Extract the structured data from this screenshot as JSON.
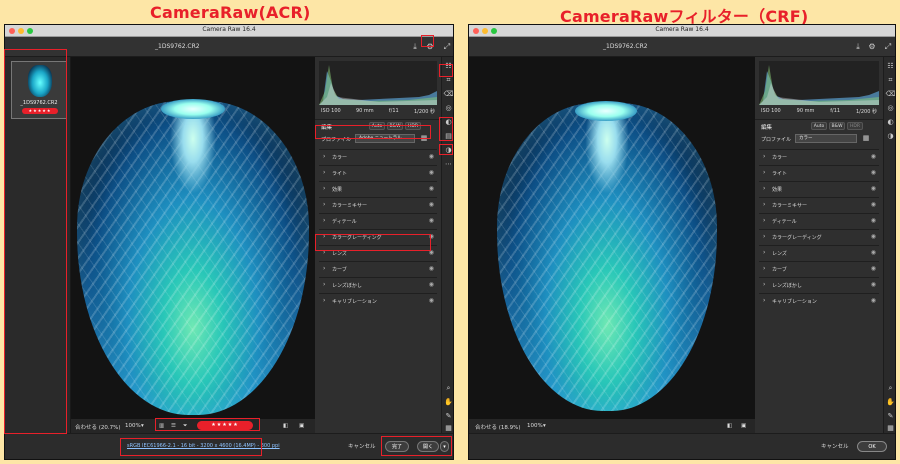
{
  "headings": {
    "acr": "CameraRaw(ACR)",
    "crf": "CameraRawフィルター（CRF)"
  },
  "colors": {
    "accent": "#e8202a",
    "panel": "#2f2f2f",
    "canvas": "#131313"
  },
  "acr": {
    "title": "Camera Raw 16.4",
    "filename": "_1DS9762.CR2",
    "filmstrip": {
      "name": "_1DS9762.CR2",
      "rating": "★★★★★"
    },
    "exif": [
      "ISO 100",
      "90 mm",
      "f/11",
      "1/200 秒"
    ],
    "edit_label": "編集",
    "auto_label": "Auto",
    "bw_label": "B&W",
    "hdr_label": "HDR",
    "profile_label": "プロファイル",
    "profile_value": "Adobe ニュートラル",
    "sections": [
      "カラー",
      "ライト",
      "効果",
      "カラーミキサー",
      "ディテール",
      "カラーグレーディング",
      "レンズ",
      "カーブ",
      "レンズぼかし",
      "キャリブレーション"
    ],
    "zoom_fit": "合わせる (20.7%)",
    "zoom_value": "100%",
    "stars": "★★★★★",
    "workflow": "sRGB IEC61966-2.1 - 16 bit - 3200 x 4600 (16.4MP) - 300 ppi",
    "cancel": "キャンセル",
    "done": "完了",
    "open": "開く"
  },
  "crf": {
    "title": "Camera Raw 16.4",
    "filename": "_1DS9762.CR2",
    "exif": [
      "ISO 100",
      "90 mm",
      "f/11",
      "1/200 秒"
    ],
    "edit_label": "編集",
    "auto_label": "Auto",
    "bw_label": "B&W",
    "hdr_label": "HDR",
    "profile_label": "プロファイル",
    "profile_value": "カラー",
    "sections": [
      "カラー",
      "ライト",
      "効果",
      "カラーミキサー",
      "ディテール",
      "カラーグレーディング",
      "レンズ",
      "カーブ",
      "レンズぼかし",
      "キャリブレーション"
    ],
    "zoom_fit": "合わせる (18.9%)",
    "zoom_value": "100%",
    "cancel": "キャンセル",
    "ok": "OK"
  }
}
